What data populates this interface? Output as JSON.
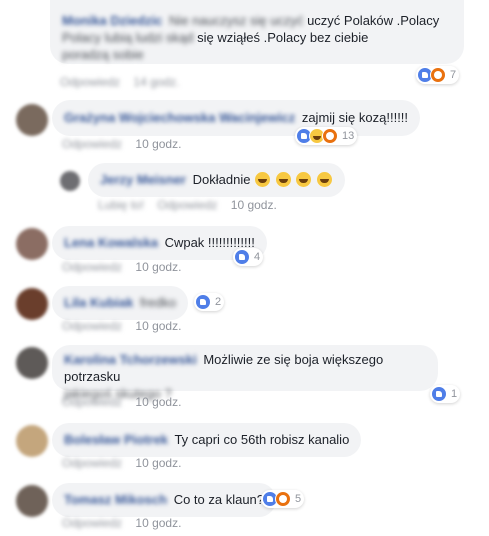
{
  "colors": {
    "like": "#4f7ee8",
    "angry": "#e9710f",
    "haha": "#f7c841",
    "author": "#385898",
    "meta": "#90949c",
    "bubble": "#f2f3f5"
  },
  "comments": [
    {
      "author": "Monika Dziedzic",
      "lead_blur": "Nie nauczysz się uczyć",
      "text": "uczyć Polaków .Polacy",
      "line2_blur": "Polacy lubią ludzi skąd",
      "line2": "się wziąłeś .Polacy bez ciebie",
      "line3_blur": "poradzą sobie",
      "reply": "Odpowiedz",
      "time": "14 godz.",
      "reactions": [
        "like",
        "angry"
      ],
      "count": "7"
    },
    {
      "author": "Grażyna Wojciechowska Wacinjewicz",
      "text": "zajmij się kozą!!!!!!",
      "reply": "Odpowiedz",
      "time": "10 godz.",
      "reactions": [
        "like",
        "haha",
        "angry"
      ],
      "count": "13"
    },
    {
      "author": "Jerzy Meisner",
      "text": "Dokładnie",
      "emoji_count": 4,
      "like_blur": "Lubię to!",
      "reply": "Odpowiedz",
      "time": "10 godz."
    },
    {
      "author": "Lena Kowalska",
      "text": "Cwpak !!!!!!!!!!!!!",
      "reply": "Odpowiedz",
      "time": "10 godz.",
      "reactions": [
        "like"
      ],
      "count": "4"
    },
    {
      "author": "Lila Kubiak",
      "text": "fredko",
      "reply": "Odpowiedz",
      "time": "10 godz.",
      "reactions": [
        "like"
      ],
      "count": "2"
    },
    {
      "author": "Karolina Tchorzewski",
      "text": "Możliwie ze się boja większego potrzasku",
      "line2_blur": "jakiegoś skutego ?",
      "reply": "Odpowiedz",
      "time": "10 godz.",
      "reactions": [
        "like"
      ],
      "count": "1"
    },
    {
      "author": "Bolesław Piotrek",
      "text": "Ty capri co 56th robisz kanalio",
      "reply": "Odpowiedz",
      "time": "10 godz."
    },
    {
      "author": "Tomasz Mikosch",
      "text": "Co to za klaun?",
      "reply": "Odpowiedz",
      "time": "10 godz.",
      "reactions": [
        "like",
        "angry"
      ],
      "count": "5"
    }
  ]
}
